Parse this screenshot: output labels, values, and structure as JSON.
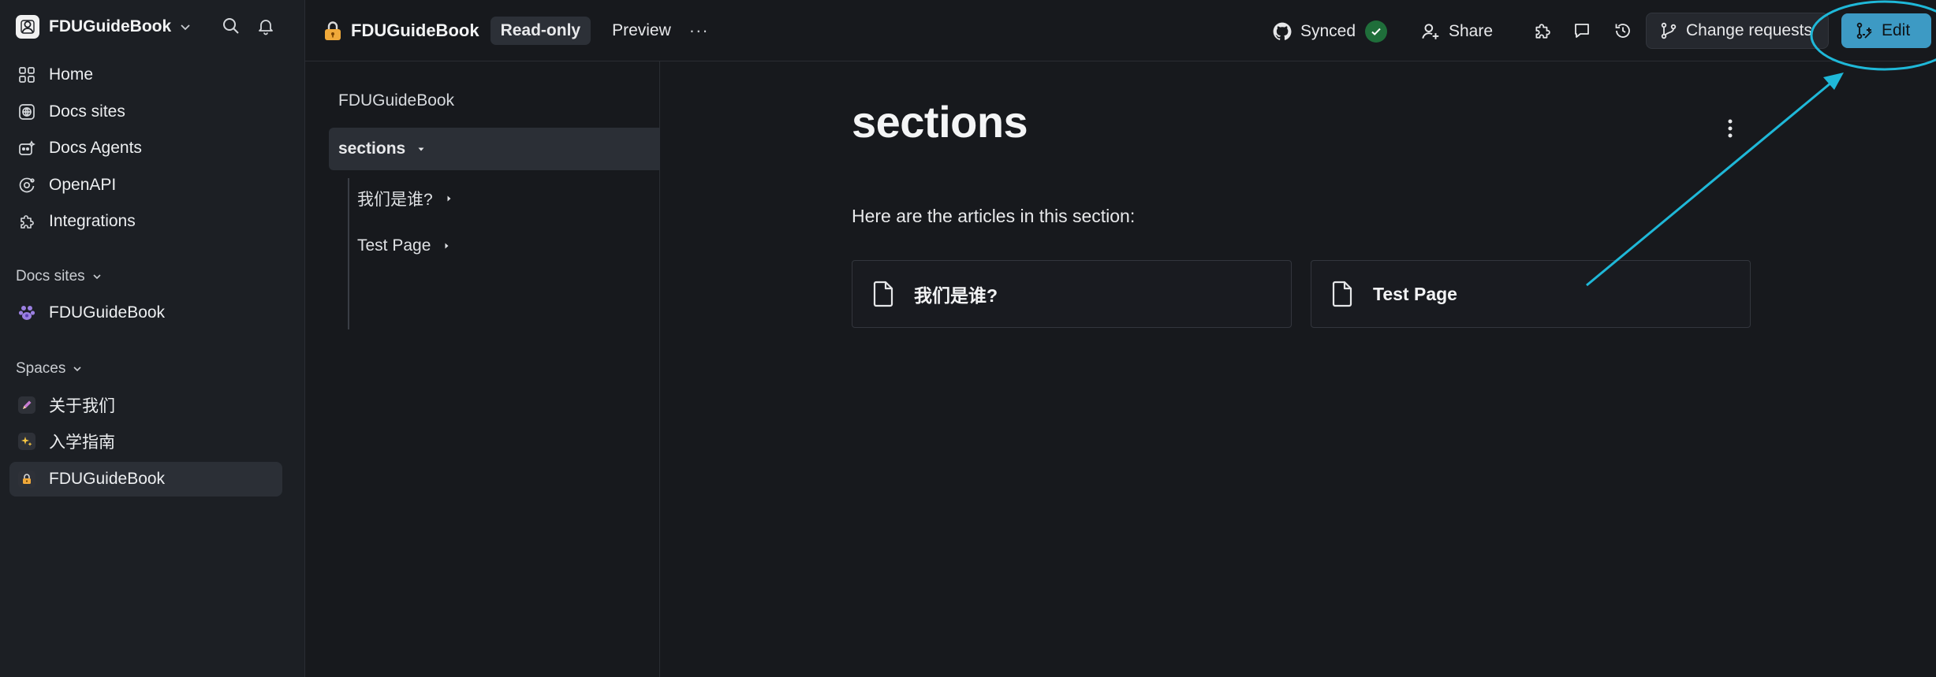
{
  "sidebar": {
    "org_name": "FDUGuideBook",
    "nav": [
      {
        "label": "Home",
        "icon": "grid-icon"
      },
      {
        "label": "Docs sites",
        "icon": "globe-icon"
      },
      {
        "label": "Docs Agents",
        "icon": "bot-icon"
      },
      {
        "label": "OpenAPI",
        "icon": "api-icon"
      },
      {
        "label": "Integrations",
        "icon": "puzzle-icon"
      }
    ],
    "docs_sites_title": "Docs sites",
    "docs_sites": [
      {
        "label": "FDUGuideBook",
        "icon": "paw-icon"
      }
    ],
    "spaces_title": "Spaces",
    "spaces": [
      {
        "label": "关于我们",
        "icon": "pen-emoji-icon"
      },
      {
        "label": "入学指南",
        "icon": "sparkles-emoji-icon"
      },
      {
        "label": "FDUGuideBook",
        "icon": "lock-emoji-icon",
        "active": true
      }
    ]
  },
  "topbar": {
    "space_title": "FDUGuideBook",
    "readonly_label": "Read-only",
    "preview_label": "Preview",
    "more_label": "···",
    "synced_label": "Synced",
    "share_label": "Share",
    "change_requests_label": "Change requests",
    "edit_label": "Edit"
  },
  "tree": {
    "root": "FDUGuideBook",
    "current": "sections",
    "children": [
      "我们是谁?",
      "Test Page"
    ]
  },
  "content": {
    "title": "sections",
    "intro": "Here are the articles in this section:",
    "cards": [
      "我们是谁?",
      "Test Page"
    ]
  },
  "colors": {
    "background": "#17191d",
    "sidebar": "#1c1f24",
    "accent_edit": "#3d9ac4",
    "annotation": "#1fb8d8",
    "synced_badge": "#1f6e3a"
  }
}
